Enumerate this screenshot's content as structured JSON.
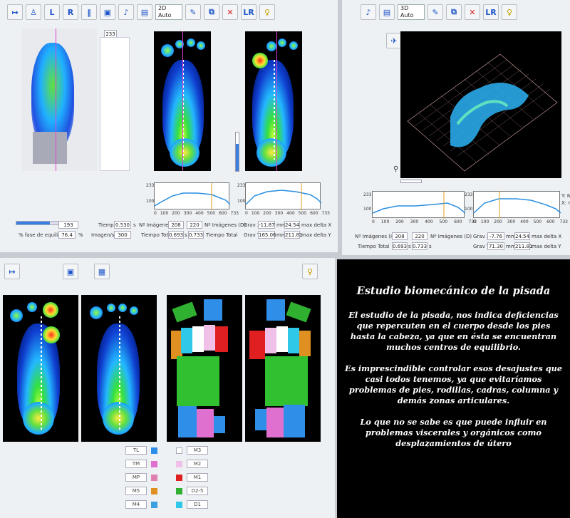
{
  "toolbar_tl": {
    "labels": [
      "L",
      "R"
    ],
    "mode_2d": "2D",
    "mode_auto": "Auto"
  },
  "toolbar_tr": {
    "mode_3d": "3D",
    "mode_auto": "Auto"
  },
  "top_left": {
    "frame_num": "233",
    "frame_zero": "0",
    "g1_y_top": "233",
    "g1_y_mid": "100",
    "g1_x": [
      "0",
      "100",
      "200",
      "300",
      "400",
      "500",
      "600",
      "733"
    ],
    "g2_y_top": "233",
    "g2_y_mid": "100",
    "g2_x": [
      "0",
      "100",
      "200",
      "300",
      "400",
      "500",
      "600",
      "733"
    ],
    "progress_val": "193",
    "fase_label": "% fase de equilibrio",
    "fase_val": "76.4",
    "fase_unit": "%",
    "tiempo_label": "Tiempo",
    "tiempo_val": "0.530",
    "tiempo_unit": "s",
    "imgs_label": "Imagen/sec",
    "imgs_val": "300",
    "nimg_label": "Nº Imágenes (I)",
    "nimg_i": "208",
    "nimg_d": "220",
    "nimg_d_label": "Nº Imágenes (D)",
    "ttotal_label": "Tiempo Total",
    "ttotal_i": "0.693",
    "ttotal_unit": "s",
    "ttotal_d": "0.733",
    "ttotal_d_label": "Tiempo Total",
    "gravx_label": "Grav X",
    "gravx_val": "-11.87",
    "gravx_mm": "mm",
    "gravx_delta": "24.54",
    "gravx_max": "max delta X",
    "gravy_label": "Grav Y",
    "gravy_val": "165.06",
    "gravy_mm": "mm",
    "gravy_delta": "211.81",
    "gravy_max": "max delta Y"
  },
  "top_right": {
    "axis_yn": "Y: N",
    "axis_xms": "X: ms",
    "g1_y_top": "233",
    "g1_y_mid": "100",
    "g1_x": [
      "0",
      "100",
      "200",
      "300",
      "400",
      "500",
      "600",
      "733"
    ],
    "g2_y_top": "233",
    "g2_y_mid": "100",
    "g2_x": [
      "0",
      "100",
      "200",
      "300",
      "400",
      "500",
      "600",
      "733"
    ],
    "nimg_label": "Nº Imágenes (I)",
    "nimg_i": "208",
    "nimg_d": "220",
    "nimg_d_label": "Nº Imágenes (D)",
    "ttotal_label": "Tiempo Total",
    "ttotal_i": "0.693",
    "ttotal_unit": "s",
    "ttotal_d": "0.733",
    "ttotal_unit2": "s",
    "gravx_label": "Grav X",
    "gravx_val": "-7.76",
    "gravx_mm": "mm",
    "gravx_delta": "24.54",
    "gravx_max": "max delta X",
    "gravy_label": "Grav Y",
    "gravy_val": "71.30",
    "gravy_mm": "mm",
    "gravy_delta": "211.81",
    "gravy_max": "max delta Y"
  },
  "legend": [
    {
      "code": "TL",
      "color": "#2f8ee8",
      "code2": "M3",
      "color2": "#ffffff"
    },
    {
      "code": "TM",
      "color": "#e070d0",
      "code2": "M2",
      "color2": "#f0c0e8"
    },
    {
      "code": "MP",
      "color": "#e080b0",
      "code2": "M1",
      "color2": "#e02020"
    },
    {
      "code": "M5",
      "color": "#e09020",
      "code2": "D2-5",
      "color2": "#30b030"
    },
    {
      "code": "M4",
      "color": "#3aa0e0",
      "code2": "D1",
      "color2": "#30c8e8"
    }
  ],
  "info": {
    "title": "Estudio biomecánico de la pisada",
    "p1": "El estudio de la pisada, nos indica deficiencias que repercuten en el cuerpo desde los pies hasta la cabeza, ya que en ésta se encuentran muchos centros de equilibrio.",
    "p2": "Es imprescindible controlar esos desajustes que casi todos tenemos, ya que evitaríamos problemas de pies, rodillas, cadras, columna y demás zonas articulares.",
    "p3": "Lo que no se sabe es que puede influir en problemas viscerales y orgánicos como desplazamientos de útero"
  }
}
